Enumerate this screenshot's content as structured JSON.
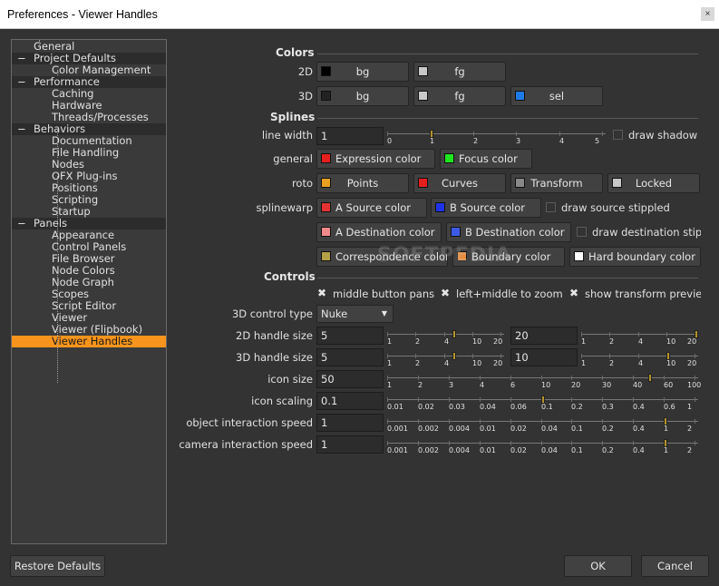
{
  "window": {
    "title": "Preferences - Viewer Handles",
    "close_glyph": "×"
  },
  "tree": [
    {
      "label": "General",
      "group": false,
      "level": 0
    },
    {
      "label": "Project Defaults",
      "group": true,
      "level": 0
    },
    {
      "label": "Color Management",
      "group": false,
      "level": 1
    },
    {
      "label": "Performance",
      "group": true,
      "level": 0
    },
    {
      "label": "Caching",
      "group": false,
      "level": 1
    },
    {
      "label": "Hardware",
      "group": false,
      "level": 1
    },
    {
      "label": "Threads/Processes",
      "group": false,
      "level": 1
    },
    {
      "label": "Behaviors",
      "group": true,
      "level": 0
    },
    {
      "label": "Documentation",
      "group": false,
      "level": 1
    },
    {
      "label": "File Handling",
      "group": false,
      "level": 1
    },
    {
      "label": "Nodes",
      "group": false,
      "level": 1
    },
    {
      "label": "OFX Plug-ins",
      "group": false,
      "level": 1
    },
    {
      "label": "Positions",
      "group": false,
      "level": 1
    },
    {
      "label": "Scripting",
      "group": false,
      "level": 1
    },
    {
      "label": "Startup",
      "group": false,
      "level": 1
    },
    {
      "label": "Panels",
      "group": true,
      "level": 0
    },
    {
      "label": "Appearance",
      "group": false,
      "level": 1
    },
    {
      "label": "Control Panels",
      "group": false,
      "level": 1
    },
    {
      "label": "File Browser",
      "group": false,
      "level": 1
    },
    {
      "label": "Node Colors",
      "group": false,
      "level": 1
    },
    {
      "label": "Node Graph",
      "group": false,
      "level": 1
    },
    {
      "label": "Scopes",
      "group": false,
      "level": 1
    },
    {
      "label": "Script Editor",
      "group": false,
      "level": 1
    },
    {
      "label": "Viewer",
      "group": false,
      "level": 1
    },
    {
      "label": "Viewer (Flipbook)",
      "group": false,
      "level": 1
    },
    {
      "label": "Viewer Handles",
      "group": false,
      "level": 1,
      "selected": true
    }
  ],
  "tree_minus_glyph": "−",
  "colors": {
    "heading": "Colors",
    "row2d_label": "2D",
    "row3d_label": "3D",
    "bg2d": {
      "label": "bg",
      "swatch": "#000000"
    },
    "fg2d": {
      "label": "fg",
      "swatch": "#c8c8c8"
    },
    "bg3d": {
      "label": "bg",
      "swatch": "#222222"
    },
    "fg3d": {
      "label": "fg",
      "swatch": "#c8c8c8"
    },
    "sel3d": {
      "label": "sel",
      "swatch": "#1e7ae6"
    }
  },
  "splines": {
    "heading": "Splines",
    "line_width_label": "line width",
    "line_width_value": "1",
    "line_width_ticks": [
      "0",
      "1",
      "2",
      "3",
      "4",
      "5"
    ],
    "line_width_knob": 1,
    "draw_shadow_label": "draw shadow",
    "draw_shadow_checked": false,
    "general_label": "general",
    "expression_color": {
      "label": "Expression color",
      "swatch": "#e61e1e"
    },
    "focus_color": {
      "label": "Focus color",
      "swatch": "#1ee61e"
    },
    "roto_label": "roto",
    "points": {
      "label": "Points",
      "swatch": "#e8a020"
    },
    "curves": {
      "label": "Curves",
      "swatch": "#e61e1e"
    },
    "transform": {
      "label": "Transform",
      "swatch": "#888888"
    },
    "locked": {
      "label": "Locked",
      "swatch": "#c8c8c8"
    },
    "splinewarp_label": "splinewarp",
    "a_source": {
      "label": "A Source color",
      "swatch": "#e63232"
    },
    "b_source": {
      "label": "B Source color",
      "swatch": "#1e32e6"
    },
    "draw_source_stippled_label": "draw source stippled",
    "draw_source_stippled_checked": false,
    "a_destination": {
      "label": "A Destination color",
      "swatch": "#f08a8a"
    },
    "b_destination": {
      "label": "B Destination color",
      "swatch": "#3c5ae6"
    },
    "draw_destination_stippled_label": "draw destination stip",
    "draw_destination_stippled_checked": false,
    "correspondence": {
      "label": "Correspondence color",
      "swatch": "#b4a046"
    },
    "boundary": {
      "label": "Boundary color",
      "swatch": "#e68c3c"
    },
    "hard_boundary": {
      "label": "Hard boundary color",
      "swatch": "#ffffff"
    }
  },
  "controls": {
    "heading": "Controls",
    "middle_button_pans": {
      "label": "middle button pans",
      "checked": true
    },
    "left_middle_zoom": {
      "label": "left+middle to zoom",
      "checked": true
    },
    "show_transform_preview": {
      "label": "show transform previe",
      "checked": true
    },
    "check_glyph": "✖",
    "control_type_label": "3D control type",
    "control_type_value": "Nuke",
    "caret_glyph": "▼",
    "handle2d_label": "2D handle size",
    "handle2d_value": "5",
    "handle2d_pick": "20",
    "handle3d_label": "3D handle size",
    "handle3d_value": "5",
    "handle3d_pick": "10",
    "handle_ticks": [
      "1",
      "2",
      "4",
      "10",
      "20"
    ],
    "icon_size_label": "icon size",
    "icon_size_value": "50",
    "icon_size_ticks": [
      "1",
      "2",
      "3",
      "4",
      "6",
      "10",
      "20",
      "30",
      "40",
      "60",
      "100"
    ],
    "icon_scaling_label": "icon scaling",
    "icon_scaling_value": "0.1",
    "icon_scaling_ticks": [
      "0.01",
      "0.02",
      "0.03",
      "0.04",
      "0.06",
      "0.1",
      "0.2",
      "0.3",
      "0.4",
      "0.6",
      "1"
    ],
    "object_speed_label": "object interaction speed",
    "object_speed_value": "1",
    "camera_speed_label": "camera interaction speed",
    "camera_speed_value": "1",
    "speed_ticks": [
      "0.001",
      "0.002",
      "0.004",
      "0.01",
      "0.02",
      "0.04",
      "0.1",
      "0.2",
      "0.4",
      "1",
      "2"
    ]
  },
  "watermark": "SOFTPEDIA",
  "footer": {
    "restore_label": "Restore Defaults",
    "ok_label": "OK",
    "cancel_label": "Cancel"
  }
}
